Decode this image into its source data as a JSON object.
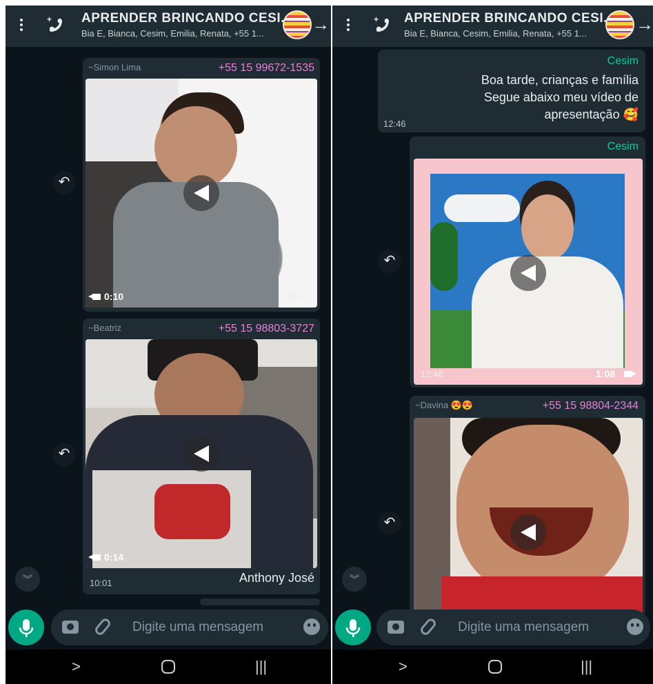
{
  "header": {
    "title": "APPRENDER BRINCANDO CESI...",
    "title_mirrored": "APRENDER BRINCANDO CESI...",
    "participants": "Bia E, Bianca, Cesim, Emilia, Renata, +55 1..."
  },
  "left": {
    "messages": [
      {
        "sender": "+55 15 99672-1535",
        "pushname": "~Simon Lima",
        "duration": "0:10",
        "time": "09:41"
      },
      {
        "sender": "+55 15 98803-3727",
        "pushname": "~Beatriz",
        "duration": "0:14",
        "caption": "Anthony José",
        "time": "10:01"
      }
    ]
  },
  "right": {
    "messages": [
      {
        "sender": "Cesim",
        "lines": [
          "Boa tarde, crianças e família",
          "Segue abaixo meu vídeo de",
          "apresentação 🥰"
        ],
        "time": "12:46"
      },
      {
        "sender": "Cesim",
        "duration": "1:08",
        "time": "12:48"
      },
      {
        "sender": "+55 15 98804-2344",
        "pushname": "~Davina 😍😍"
      }
    ]
  },
  "input": {
    "placeholder": "Digite uma mensagem"
  },
  "icons": {
    "menu": "more-vert-icon",
    "call": "add-call-icon",
    "back": "arrow-icon",
    "emoji": "emoji-icon",
    "attach": "paperclip-icon",
    "camera": "camera-icon",
    "mic": "mic-icon",
    "reply": "forward-icon",
    "scroll": "double-chevron-down-icon"
  },
  "colors": {
    "bg": "#0b141a",
    "bubble": "#1f2c34",
    "accent": "#00a884",
    "sender_cesim": "#06cf9c",
    "sender_pink": "#e680d8"
  }
}
